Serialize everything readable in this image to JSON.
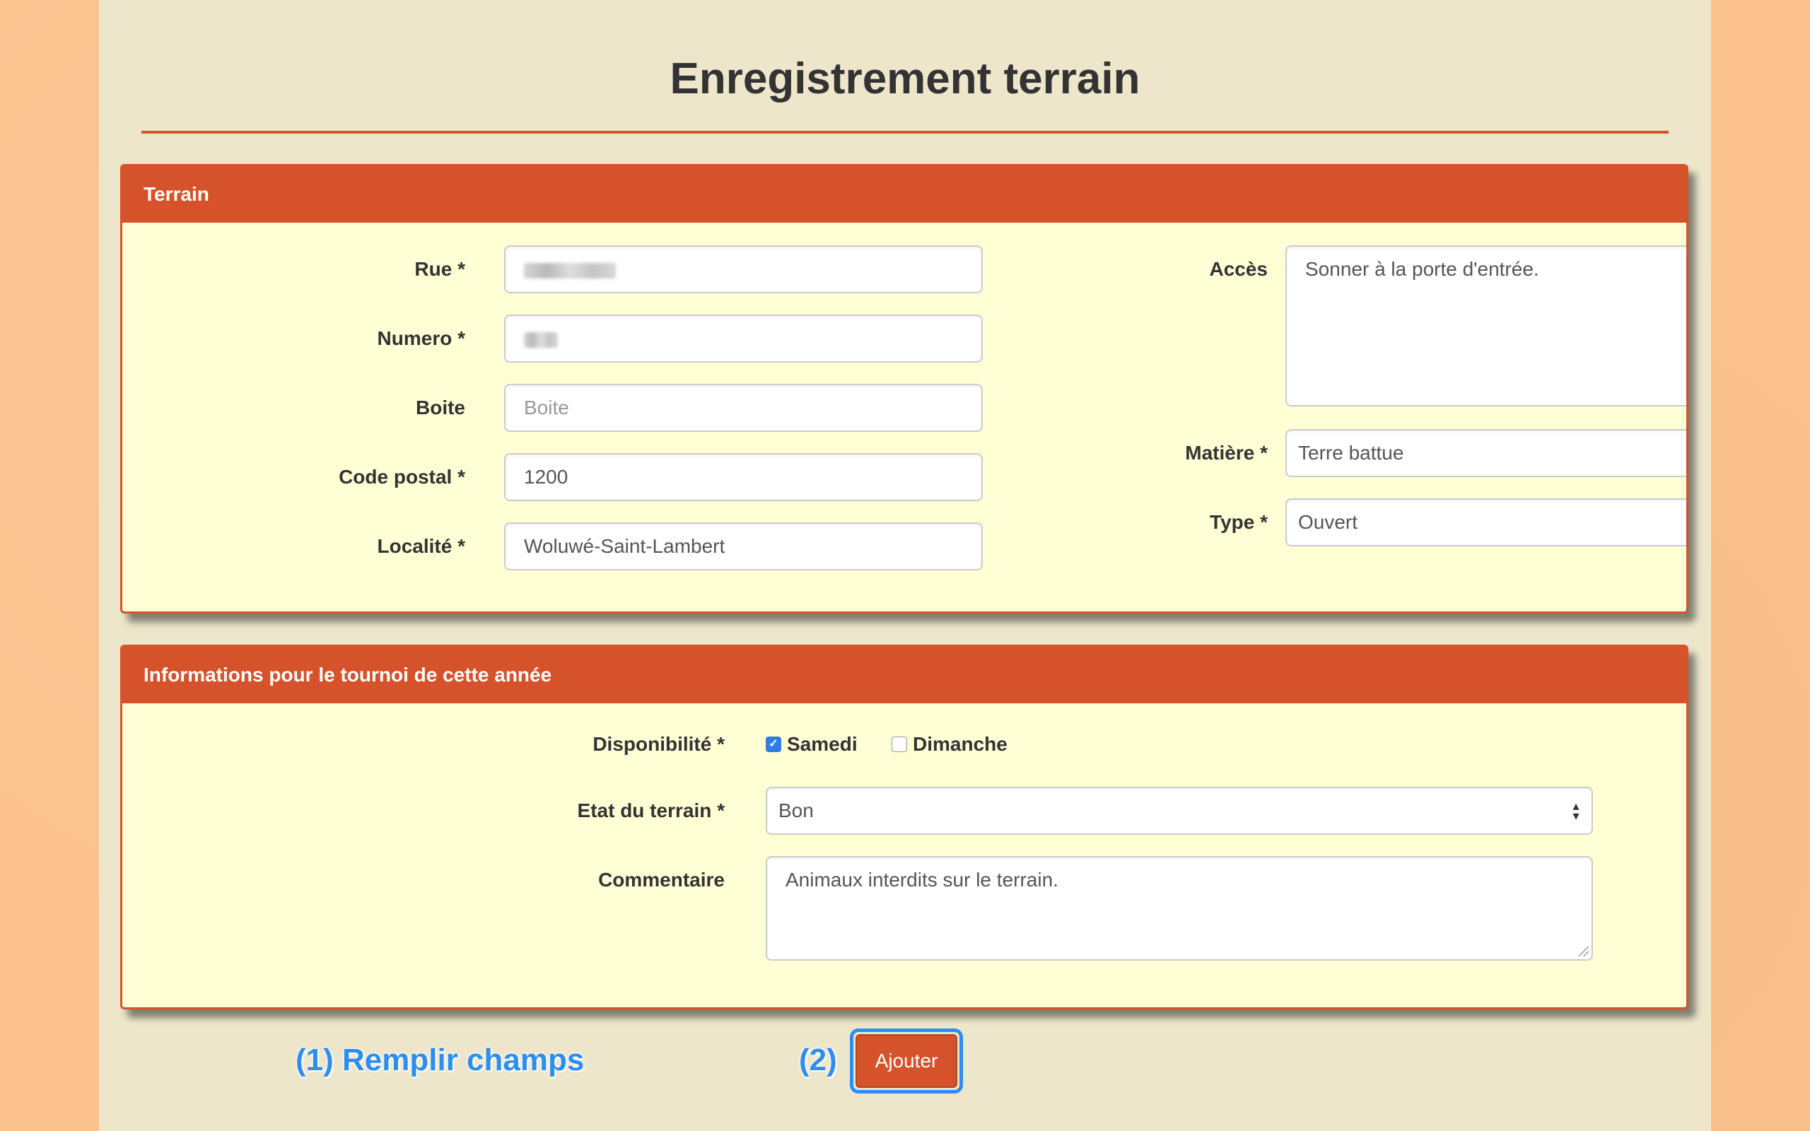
{
  "page": {
    "title": "Enregistrement terrain"
  },
  "panel_terrain": {
    "heading": "Terrain",
    "rue": {
      "label": "Rue *"
    },
    "numero": {
      "label": "Numero *"
    },
    "boite": {
      "label": "Boite",
      "placeholder": "Boite"
    },
    "code_postal": {
      "label": "Code postal *",
      "value": "1200"
    },
    "localite": {
      "label": "Localité *",
      "value": "Woluwé-Saint-Lambert"
    },
    "acces": {
      "label": "Accès",
      "value": "Sonner à la porte d'entrée."
    },
    "matiere": {
      "label": "Matière *",
      "value": "Terre battue"
    },
    "type": {
      "label": "Type *",
      "value": "Ouvert"
    }
  },
  "panel_tournoi": {
    "heading": "Informations pour le tournoi de cette année",
    "disponibilite": {
      "label": "Disponibilité *",
      "options": [
        {
          "label": "Samedi",
          "checked": true
        },
        {
          "label": "Dimanche",
          "checked": false
        }
      ]
    },
    "etat": {
      "label": "Etat du terrain *",
      "value": "Bon"
    },
    "commentaire": {
      "label": "Commentaire",
      "value": "Animaux interdits sur le terrain."
    }
  },
  "annotations": {
    "step1": "(1) Remplir champs",
    "step2": "(2)"
  },
  "actions": {
    "submit_label": "Ajouter"
  },
  "colors": {
    "accent": "#d5522a",
    "panel_bg": "#ffffd6",
    "page_bg": "#eee6cb",
    "annotation": "#2b8ef0"
  }
}
